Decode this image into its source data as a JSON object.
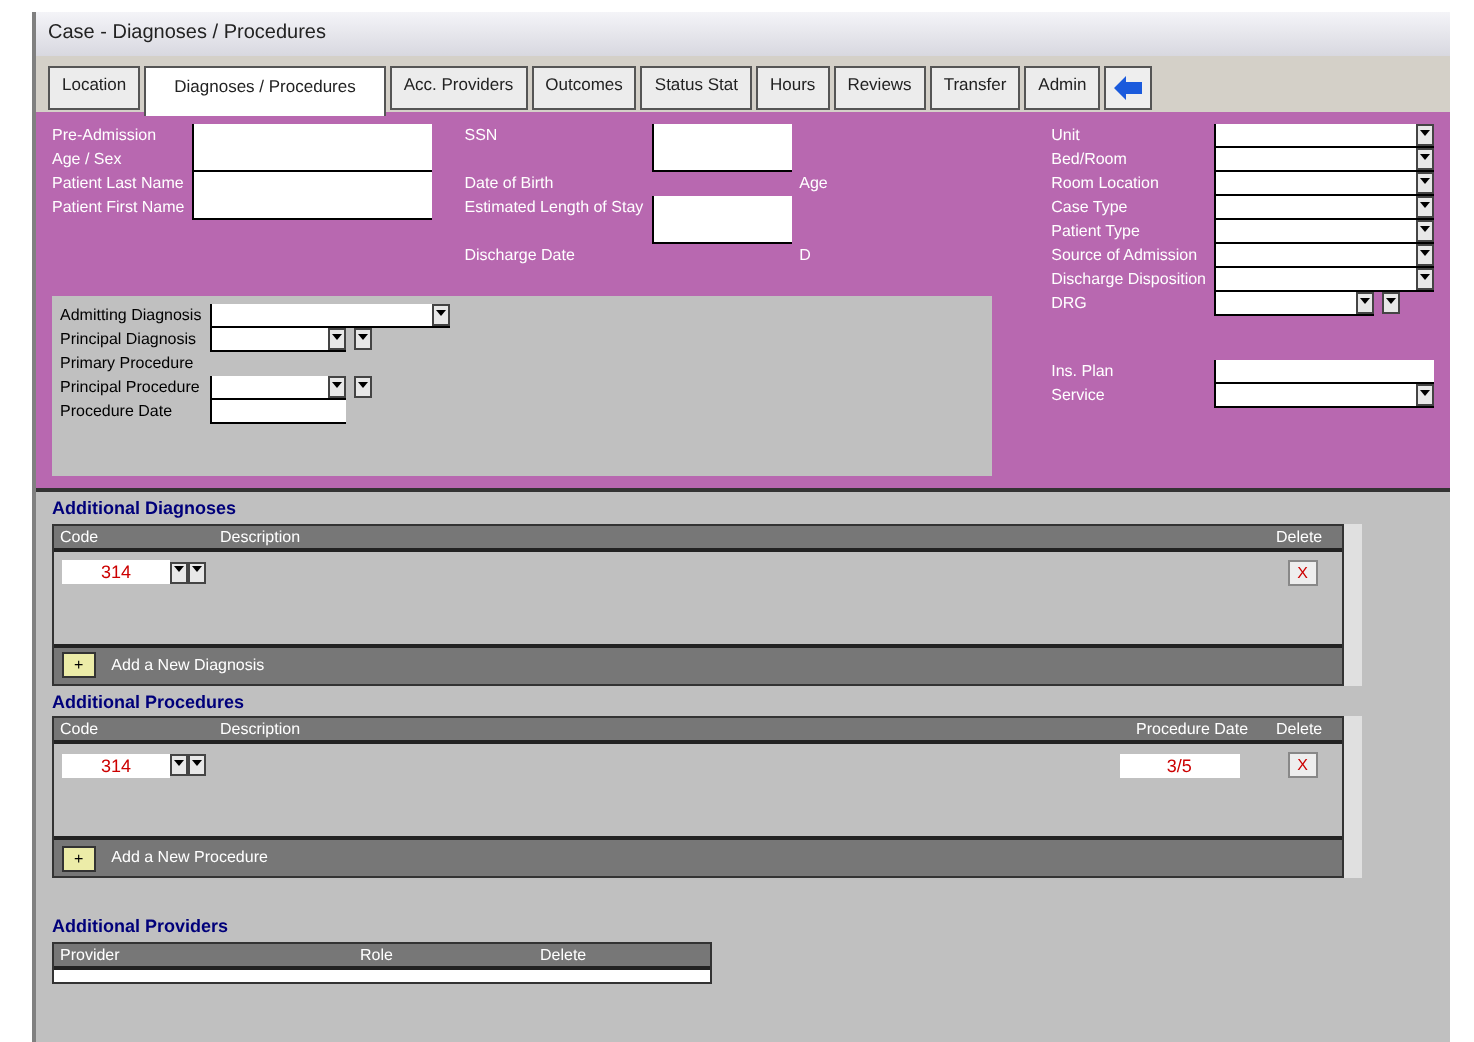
{
  "window": {
    "title": "Case - Diagnoses / Procedures"
  },
  "tabs": [
    {
      "label": "Location",
      "selected": false
    },
    {
      "label": "Diagnoses / Procedures",
      "selected": true
    },
    {
      "label": "Acc. Providers",
      "selected": false
    },
    {
      "label": "Outcomes",
      "selected": false
    },
    {
      "label": "Status Stat",
      "selected": false
    },
    {
      "label": "Hours",
      "selected": false
    },
    {
      "label": "Reviews",
      "selected": false
    },
    {
      "label": "Transfer",
      "selected": false
    },
    {
      "label": "Admin",
      "selected": false
    }
  ],
  "header_left": [
    {
      "label": "Pre-Admission",
      "kind": "text"
    },
    {
      "label": "Age / Sex",
      "kind": "none"
    },
    {
      "label": "Patient Last Name",
      "kind": "text"
    },
    {
      "label": "Patient First Name",
      "kind": "none"
    }
  ],
  "header_mid": [
    {
      "label": "SSN",
      "kind": "text"
    },
    {
      "label": "Date of Birth",
      "kind": "none",
      "suffix": "Age"
    },
    {
      "label": "Estimated Length of Stay",
      "kind": "text"
    },
    {
      "label": "Discharge Date",
      "kind": "none",
      "suffix": "D"
    }
  ],
  "diagnosis_fields": [
    {
      "label": "Admitting Diagnosis",
      "kind": "combo"
    },
    {
      "label": "Principal Diagnosis",
      "kind": "lookup"
    },
    {
      "label": "Primary Procedure",
      "kind": "none"
    },
    {
      "label": "Principal Procedure",
      "kind": "lookup"
    },
    {
      "label": "Procedure Date",
      "kind": "text"
    }
  ],
  "header_right": [
    {
      "label": "Unit",
      "kind": "combo"
    },
    {
      "label": "Bed/Room",
      "kind": "combo"
    },
    {
      "label": "Room Location",
      "kind": "combo"
    },
    {
      "label": "Case Type",
      "kind": "combo"
    },
    {
      "label": "Patient Type",
      "kind": "combo"
    },
    {
      "label": "Source of Admission",
      "kind": "combo"
    },
    {
      "label": "Discharge Disposition",
      "kind": "combo"
    },
    {
      "label": "DRG",
      "kind": "lookup"
    },
    {
      "kind": "gap"
    },
    {
      "label": "Ins. Plan",
      "kind": "text"
    },
    {
      "label": "Service",
      "kind": "combo"
    }
  ],
  "additional_diagnoses": {
    "title": "Additional Diagnoses",
    "columns": [
      "Code",
      "Description",
      "Delete"
    ],
    "rows": [
      {
        "code": "314",
        "delete": "X"
      }
    ],
    "add_button": "+",
    "add_label": "Add a New Diagnosis"
  },
  "additional_procedures": {
    "title": "Additional Procedures",
    "columns": [
      "Code",
      "Description",
      "Procedure Date",
      "Delete"
    ],
    "rows": [
      {
        "code": "314",
        "date": "3/5",
        "delete": "X"
      }
    ],
    "add_button": "+",
    "add_label": "Add a New Procedure"
  },
  "additional_providers": {
    "title": "Additional Providers",
    "columns": [
      "Provider",
      "Role",
      "Delete"
    ]
  }
}
